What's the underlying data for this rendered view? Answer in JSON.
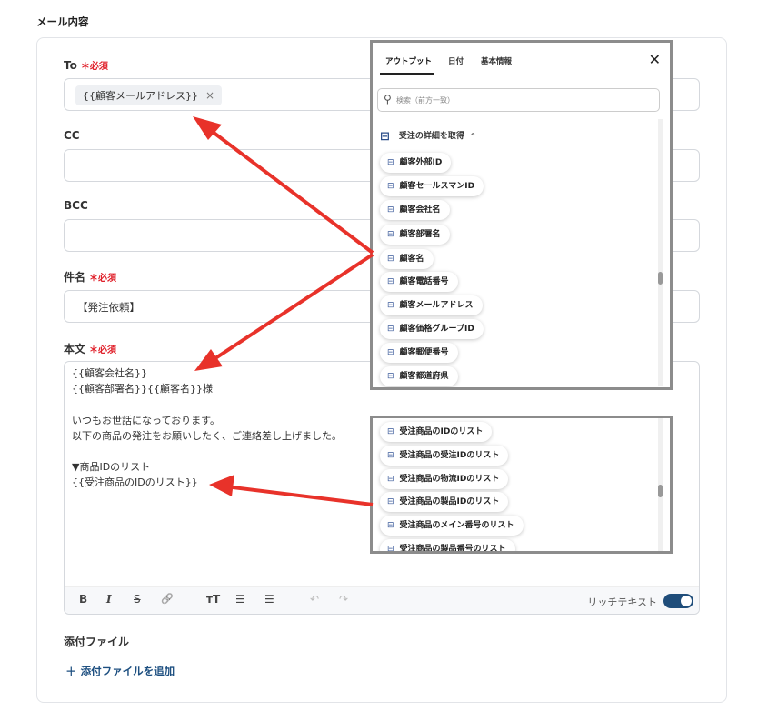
{
  "section_title": "メール内容",
  "required_mark": "＊",
  "required_text": "必須",
  "to": {
    "label": "To",
    "chip": "{{顧客メールアドレス}}",
    "chip_remove": "×"
  },
  "cc": {
    "label": "CC",
    "value": ""
  },
  "bcc": {
    "label": "BCC",
    "value": ""
  },
  "subject": {
    "label": "件名",
    "value": "【発注依頼】"
  },
  "body": {
    "label": "本文",
    "text": "{{顧客会社名}}\n{{顧客部署名}}{{顧客名}}様\n\nいつもお世話になっております。\n以下の商品の発注をお願いしたく、ご連絡差し上げました。\n\n▼商品IDのリスト\n{{受注商品のIDのリスト}}"
  },
  "toolbar": {
    "bold": "B",
    "italic": "I",
    "strike": "S",
    "link": "🔗",
    "text_size": "ᴛT",
    "bullet_list": "☰",
    "ordered_list": "☰",
    "undo": "↶",
    "redo": "↷",
    "rich_text_label": "リッチテキスト",
    "rich_text_on": true
  },
  "attachments": {
    "label": "添付ファイル",
    "add_label": "添付ファイルを追加",
    "add_icon": "+"
  },
  "popup_top": {
    "tabs": [
      "アウトプット",
      "日付",
      "基本情報"
    ],
    "active_tab": 0,
    "close": "✕",
    "search_placeholder": "検索（前方一致）",
    "group": "受注の詳細を取得",
    "items": [
      "顧客外部ID",
      "顧客セールスマンID",
      "顧客会社名",
      "顧客部署名",
      "顧客名",
      "顧客電話番号",
      "顧客メールアドレス",
      "顧客価格グループID",
      "顧客郵便番号",
      "顧客都道府県"
    ]
  },
  "popup_bottom": {
    "items": [
      "受注商品のIDのリスト",
      "受注商品の受注IDのリスト",
      "受注商品の物流IDのリスト",
      "受注商品の製品IDのリスト",
      "受注商品のメイン番号のリスト",
      "受注商品の製品番号のリスト"
    ]
  },
  "colors": {
    "accent": "#1f4d7a",
    "required": "#e0202a",
    "arrow": "#e8322a",
    "panel_border": "#8c8c8c"
  }
}
